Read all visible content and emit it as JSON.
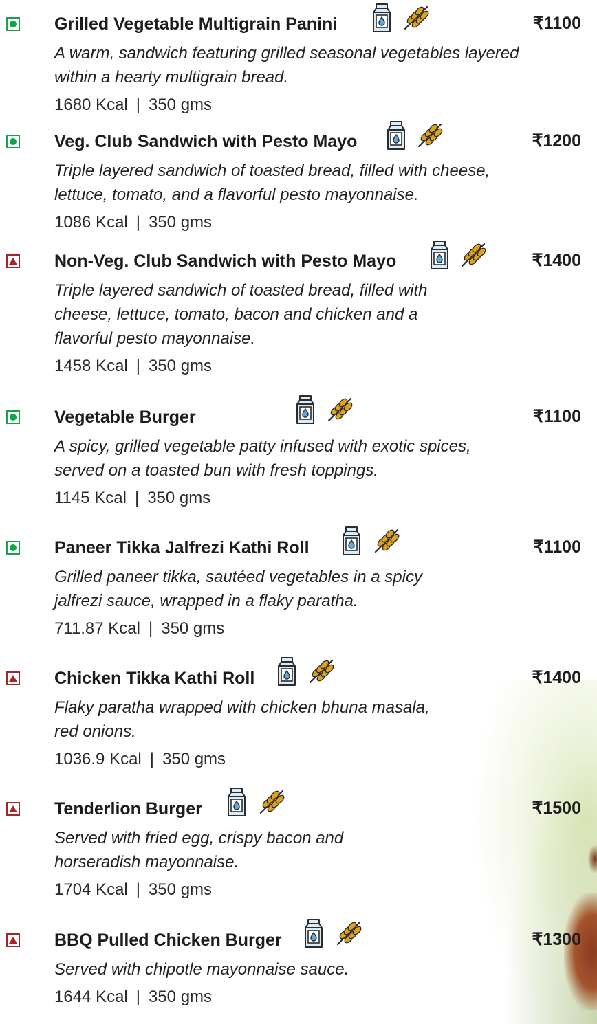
{
  "colors": {
    "veg": "#15a34a",
    "nonveg": "#a4262c",
    "milk": "#5aa9e6",
    "wheat": "#e0a11b"
  },
  "icons": {
    "dairy": "milk-carton-icon",
    "gluten": "wheat-icon"
  },
  "items": [
    {
      "name": "Grilled Vegetable Multigrain Panini",
      "type": "veg",
      "price": "₹1100",
      "desc": [
        "A warm, sandwich featuring grilled seasonal vegetables layered",
        "within a hearty multigrain bread."
      ],
      "kcal": "1680 Kcal",
      "weight": "350 gms"
    },
    {
      "name": "Veg. Club Sandwich with Pesto Mayo",
      "type": "veg",
      "price": "₹1200",
      "desc": [
        "Triple layered sandwich of toasted bread, filled with  cheese,",
        "lettuce, tomato, and a flavorful pesto mayonnaise."
      ],
      "kcal": "1086 Kcal",
      "weight": "350 gms"
    },
    {
      "name": "Non-Veg. Club Sandwich with Pesto Mayo",
      "type": "nonveg",
      "price": "₹1400",
      "desc": [
        "Triple layered sandwich of toasted bread, filled with",
        "cheese, lettuce, tomato, bacon and chicken and a",
        "flavorful pesto mayonnaise."
      ],
      "kcal": "1458 Kcal",
      "weight": "350 gms"
    },
    {
      "name": "Vegetable Burger",
      "type": "veg",
      "price": "₹1100",
      "desc": [
        "A spicy, grilled vegetable patty infused with exotic spices,",
        "served on a toasted bun with fresh toppings."
      ],
      "kcal": "1145 Kcal",
      "weight": "350 gms"
    },
    {
      "name": "Paneer Tikka Jalfrezi Kathi Roll",
      "type": "veg",
      "price": "₹1100",
      "desc": [
        "Grilled paneer tikka, sautéed vegetables in a spicy",
        "jalfrezi sauce, wrapped in a flaky paratha."
      ],
      "kcal": "711.87 Kcal",
      "weight": "350 gms"
    },
    {
      "name": "Chicken Tikka Kathi Roll",
      "type": "nonveg",
      "price": "₹1400",
      "desc": [
        "Flaky paratha wrapped with chicken bhuna masala,",
        "red onions."
      ],
      "kcal": "1036.9 Kcal",
      "weight": "350 gms"
    },
    {
      "name": "Tenderlion Burger",
      "type": "nonveg",
      "price": "₹1500",
      "desc": [
        "Served with fried egg, crispy bacon and",
        "horseradish mayonnaise."
      ],
      "kcal": "1704 Kcal",
      "weight": "350 gms"
    },
    {
      "name": "BBQ Pulled Chicken Burger",
      "type": "nonveg",
      "price": "₹1300",
      "desc": [
        "Served with chipotle mayonnaise sauce."
      ],
      "kcal": "1644 Kcal",
      "weight": "350 gms"
    }
  ]
}
